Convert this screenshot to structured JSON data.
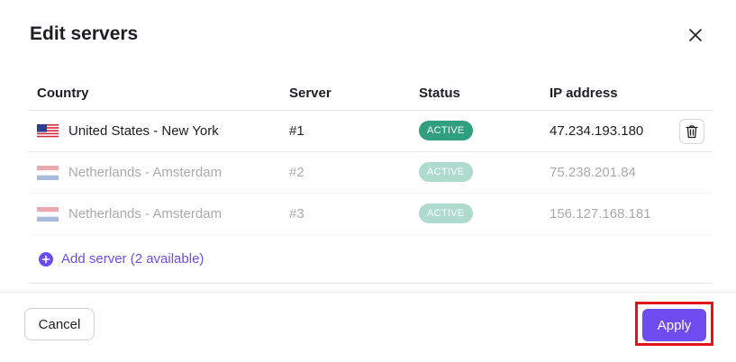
{
  "dialog": {
    "title": "Edit servers",
    "close_icon": "close-icon"
  },
  "table": {
    "headers": {
      "country": "Country",
      "server": "Server",
      "status": "Status",
      "ip": "IP address"
    },
    "rows": [
      {
        "country": "United States - New York",
        "flag": "us-flag-icon",
        "server": "#1",
        "status": "ACTIVE",
        "ip": "47.234.193.180",
        "enabled": true
      },
      {
        "country": "Netherlands - Amsterdam",
        "flag": "nl-flag-icon",
        "server": "#2",
        "status": "ACTIVE",
        "ip": "75.238.201.84",
        "enabled": false
      },
      {
        "country": "Netherlands - Amsterdam",
        "flag": "nl-flag-icon",
        "server": "#3",
        "status": "ACTIVE",
        "ip": "156.127.168.181",
        "enabled": false
      }
    ],
    "add_server_label": "Add server (2 available)"
  },
  "footer": {
    "cancel_label": "Cancel",
    "apply_label": "Apply"
  },
  "colors": {
    "accent": "#6e4cf0",
    "status_active": "#2f9f80",
    "highlight": "#e2141b"
  }
}
